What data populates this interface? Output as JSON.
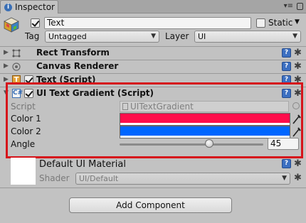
{
  "window": {
    "tab_title": "Inspector",
    "menu_glyph": "▾≡"
  },
  "object": {
    "active": true,
    "name": "Text",
    "static_label": "Static",
    "static_checked": false,
    "tag_label": "Tag",
    "tag_value": "Untagged",
    "layer_label": "Layer",
    "layer_value": "UI"
  },
  "components": [
    {
      "title": "Rect Transform",
      "icon": "rect-transform-icon",
      "has_checkbox": false
    },
    {
      "title": "Canvas Renderer",
      "icon": "canvas-renderer-icon",
      "has_checkbox": false
    },
    {
      "title": "Text (Script)",
      "icon": "text-script-icon",
      "has_checkbox": true,
      "checked": true
    },
    {
      "title": "UI Text Gradient (Script)",
      "icon": "script-icon",
      "has_checkbox": true,
      "checked": true
    }
  ],
  "gradient": {
    "script_label": "Script",
    "script_value": "UITextGradient",
    "color1_label": "Color 1",
    "color1": "#ff0d4b",
    "color2_label": "Color 2",
    "color2": "#0066ff",
    "angle_label": "Angle",
    "angle_value": "45",
    "angle_fraction": 0.625
  },
  "material": {
    "name": "Default UI Material",
    "shader_label": "Shader",
    "shader_value": "UI/Default"
  },
  "add_component_label": "Add Component",
  "colors": {
    "highlight": "#d6141b",
    "help_button": "#3c6fc1"
  }
}
